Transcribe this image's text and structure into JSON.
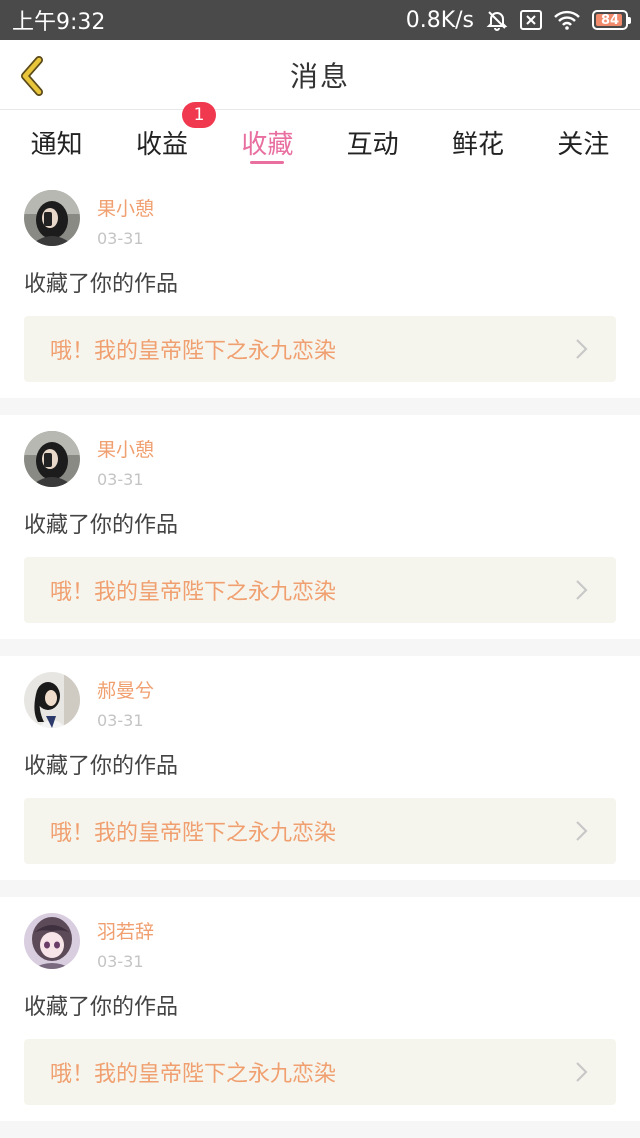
{
  "status_bar": {
    "time": "上午9:32",
    "network_speed": "0.8K/s",
    "battery_level": "84"
  },
  "nav": {
    "title": "消息"
  },
  "tabs": [
    {
      "label": "通知"
    },
    {
      "label": "收益",
      "badge": "1"
    },
    {
      "label": "收藏",
      "active": true
    },
    {
      "label": "互动"
    },
    {
      "label": "鲜花"
    },
    {
      "label": "关注"
    }
  ],
  "feed": [
    {
      "user": "果小憩",
      "date": "03-31",
      "action": "收藏了你的作品",
      "work_title": "哦！我的皇帝陛下之永九恋染",
      "avatar_icon": "avatar-photo-girl"
    },
    {
      "user": "果小憩",
      "date": "03-31",
      "action": "收藏了你的作品",
      "work_title": "哦！我的皇帝陛下之永九恋染",
      "avatar_icon": "avatar-photo-girl"
    },
    {
      "user": "郝曼兮",
      "date": "03-31",
      "action": "收藏了你的作品",
      "work_title": "哦！我的皇帝陛下之永九恋染",
      "avatar_icon": "avatar-photo-girl-side"
    },
    {
      "user": "羽若辞",
      "date": "03-31",
      "action": "收藏了你的作品",
      "work_title": "哦！我的皇帝陛下之永九恋染",
      "avatar_icon": "avatar-anime-girl"
    }
  ],
  "colors": {
    "accent": "#e86fa0",
    "username": "#f0a070",
    "badge": "#f0384f",
    "back_arrow": "#e8c53a"
  }
}
